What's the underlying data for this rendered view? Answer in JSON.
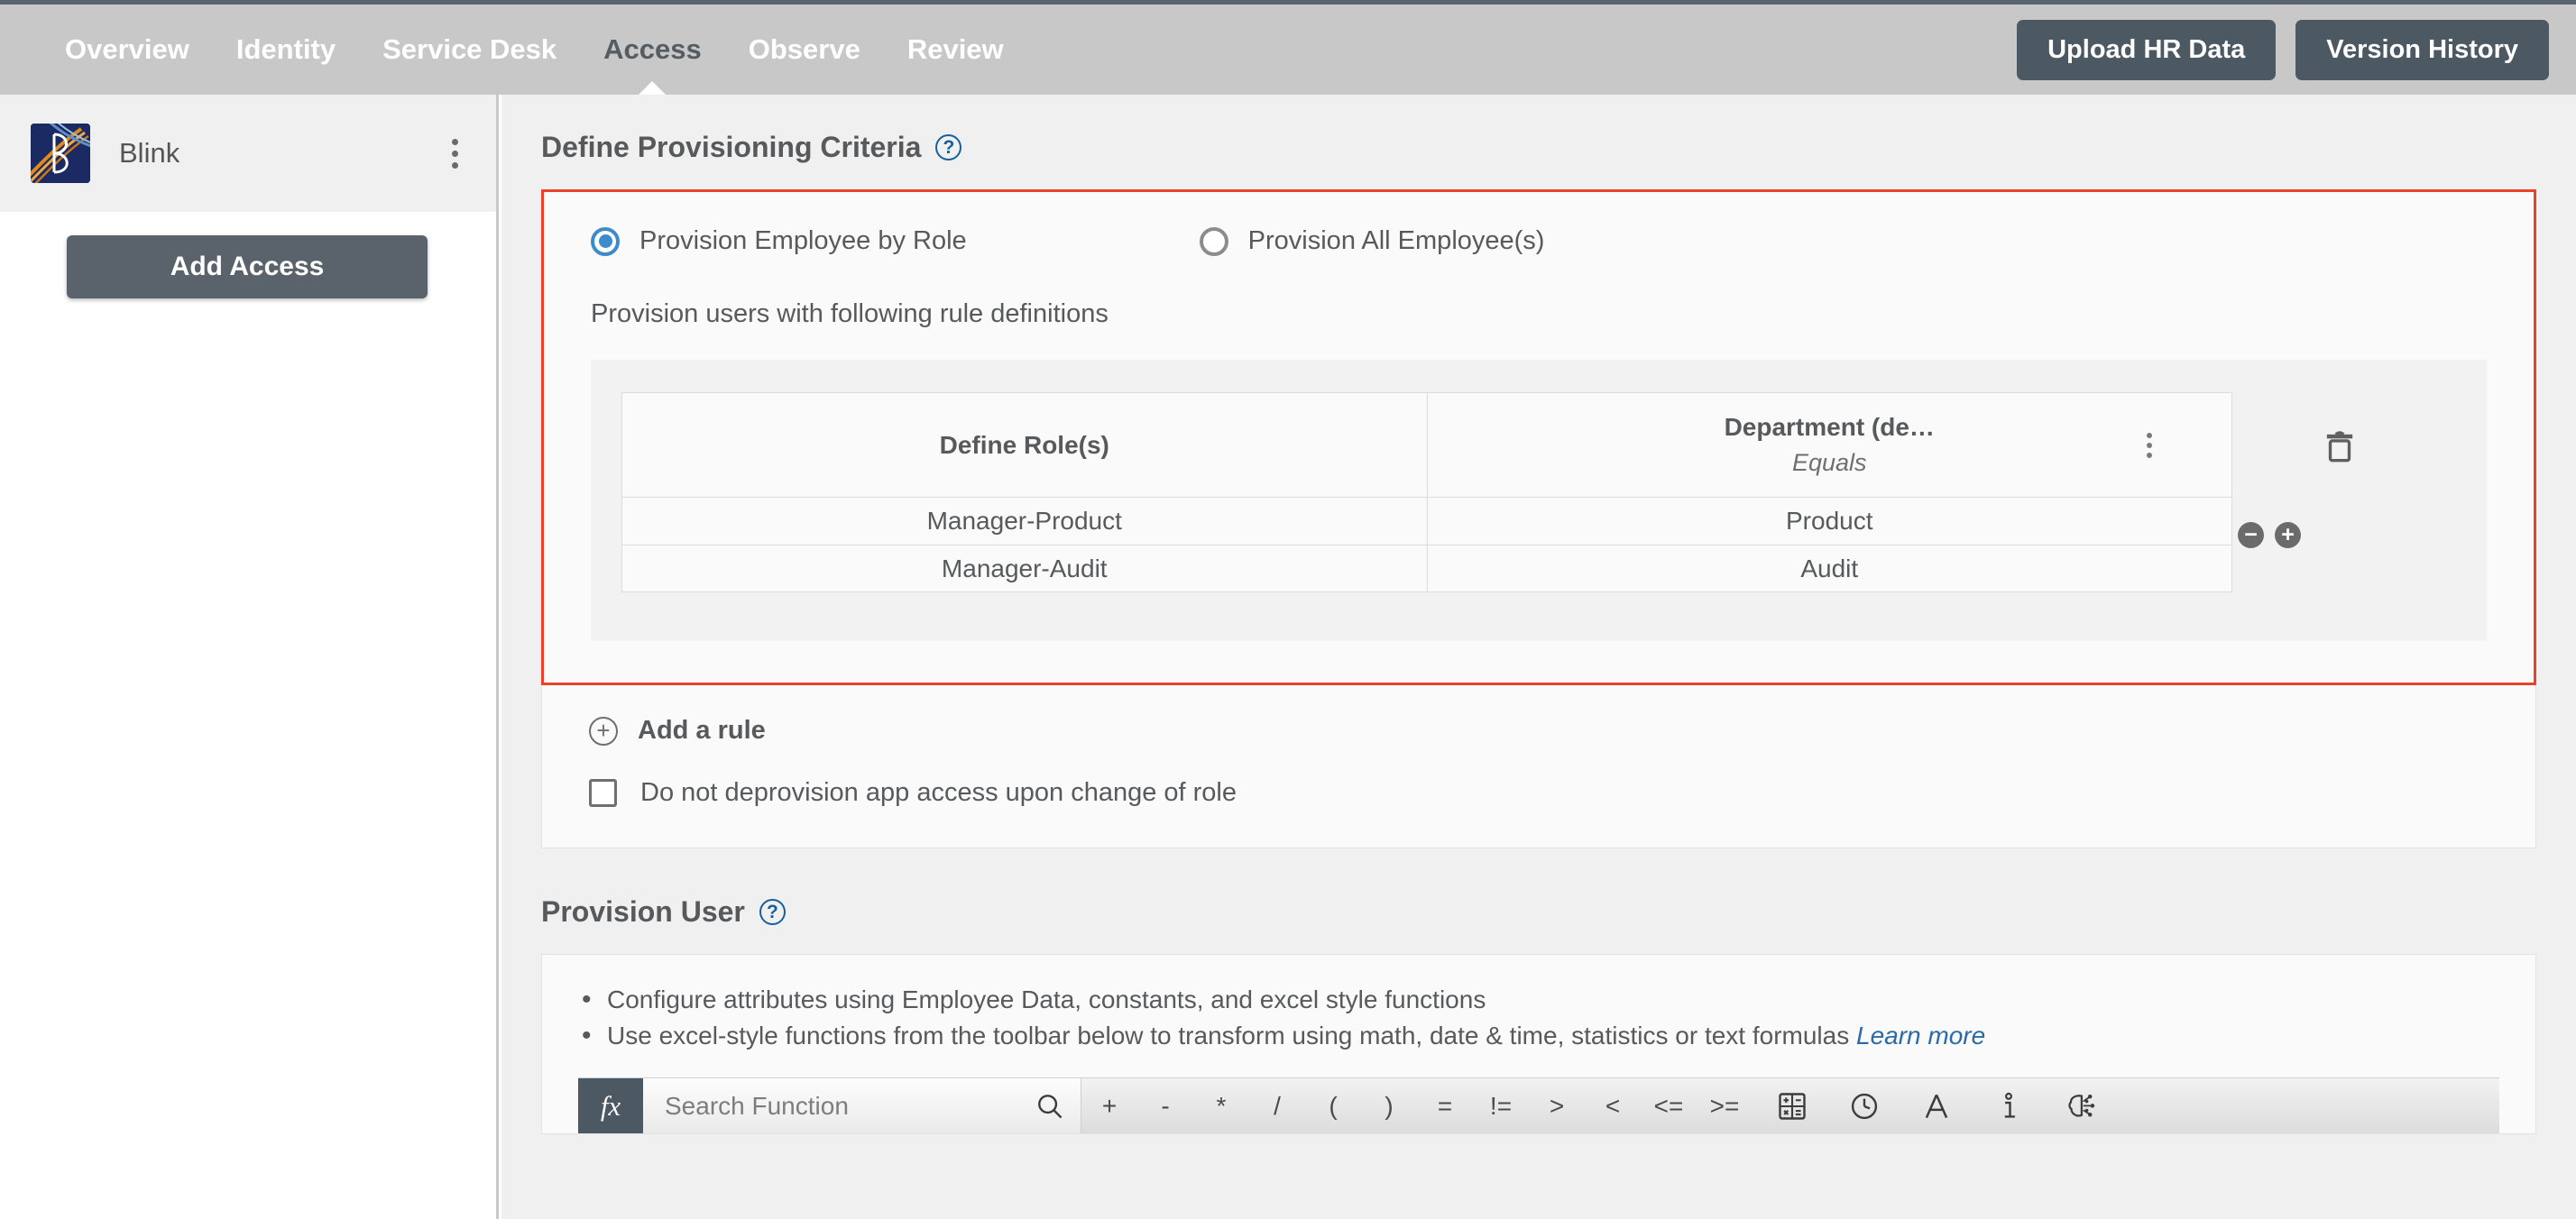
{
  "topnav": {
    "items": [
      {
        "label": "Overview",
        "active": false
      },
      {
        "label": "Identity",
        "active": false
      },
      {
        "label": "Service Desk",
        "active": false
      },
      {
        "label": "Access",
        "active": true
      },
      {
        "label": "Observe",
        "active": false
      },
      {
        "label": "Review",
        "active": false
      }
    ],
    "upload_button": "Upload HR Data",
    "version_button": "Version History",
    "bg_color": "#c8c8c8",
    "button_color": "#4c5862"
  },
  "sidebar": {
    "app_name": "Blink",
    "kebab_icon": "more-vertical-icon",
    "add_access_button": "Add Access"
  },
  "criteria": {
    "title": "Define Provisioning Criteria",
    "help_icon": "question-circle-icon",
    "highlight_color": "#e8432a",
    "radio_options": [
      {
        "label": "Provision Employee by Role",
        "selected": true
      },
      {
        "label": "Provision All Employee(s)",
        "selected": false
      }
    ],
    "rule_subtitle": "Provision users with following rule definitions",
    "table": {
      "columns": [
        {
          "label": "Define Role(s)",
          "operator": ""
        },
        {
          "label": "Department (de…",
          "operator": "Equals"
        }
      ],
      "rows": [
        {
          "role": "Manager-Product",
          "department": "Product"
        },
        {
          "role": "Manager-Audit",
          "department": "Audit"
        }
      ],
      "menu_icon": "more-vertical-icon",
      "delete_icon": "trash-icon",
      "remove_row_label": "−",
      "add_row_label": "+"
    },
    "add_rule_label": "Add a rule",
    "add_rule_icon": "plus-circle-icon",
    "deprovision_checkbox": {
      "label": "Do not deprovision app access upon change of role",
      "checked": false
    }
  },
  "provision_user": {
    "title": "Provision User",
    "help_icon": "question-circle-icon",
    "bullets": [
      "Configure attributes using Employee Data, constants, and excel style functions",
      "Use excel-style functions from the toolbar below to transform using math, date & time, statistics or text formulas"
    ],
    "learn_more": "Learn more",
    "toolbar": {
      "fx_label": "fx",
      "search_placeholder": "Search Function",
      "search_value": "",
      "search_icon": "search-icon",
      "operators": [
        "+",
        "-",
        "*",
        "/",
        "(",
        ")",
        "=",
        "!=",
        ">",
        "<",
        "<=",
        ">="
      ],
      "icons": [
        {
          "name": "calculator-icon",
          "title": "math"
        },
        {
          "name": "clock-icon",
          "title": "date & time"
        },
        {
          "name": "text-a-icon",
          "title": "text"
        },
        {
          "name": "info-icon",
          "title": "statistics"
        },
        {
          "name": "brain-ai-icon",
          "title": "ai"
        }
      ]
    }
  }
}
